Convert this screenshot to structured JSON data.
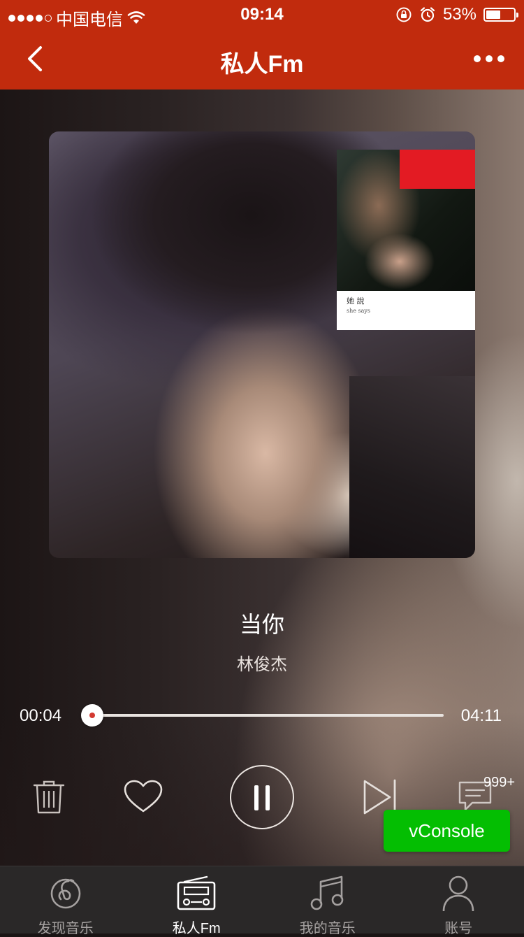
{
  "status_bar": {
    "carrier": "中国电信",
    "time": "09:14",
    "battery_percent": "53%",
    "battery_level": 0.53,
    "signal_bars_filled": 4,
    "signal_bars_total": 5
  },
  "nav": {
    "title": "私人Fm",
    "back_icon": "chevron-left-icon",
    "more_icon": "more-horizontal-icon"
  },
  "album": {
    "cover_text": "她 說",
    "cover_subtext": "she says"
  },
  "song": {
    "title": "当你",
    "artist": "林俊杰"
  },
  "progress": {
    "current": "00:04",
    "total": "04:11",
    "fraction": 0.016
  },
  "controls": {
    "trash_icon": "trash-icon",
    "like_icon": "heart-icon",
    "pause_icon": "pause-icon",
    "next_icon": "next-track-icon",
    "comment_icon": "comment-icon",
    "comment_count": "999+"
  },
  "vconsole": {
    "label": "vConsole",
    "color": "#04be02"
  },
  "tabbar": {
    "items": [
      {
        "label": "发现音乐",
        "icon": "netease-music-icon",
        "active": false
      },
      {
        "label": "私人Fm",
        "icon": "radio-icon",
        "active": true
      },
      {
        "label": "我的音乐",
        "icon": "music-note-icon",
        "active": false
      },
      {
        "label": "账号",
        "icon": "user-icon",
        "active": false
      }
    ]
  },
  "colors": {
    "brand_red": "#c12b0d",
    "progress_red": "#d33a31",
    "tabbar_bg": "#2a2828"
  }
}
